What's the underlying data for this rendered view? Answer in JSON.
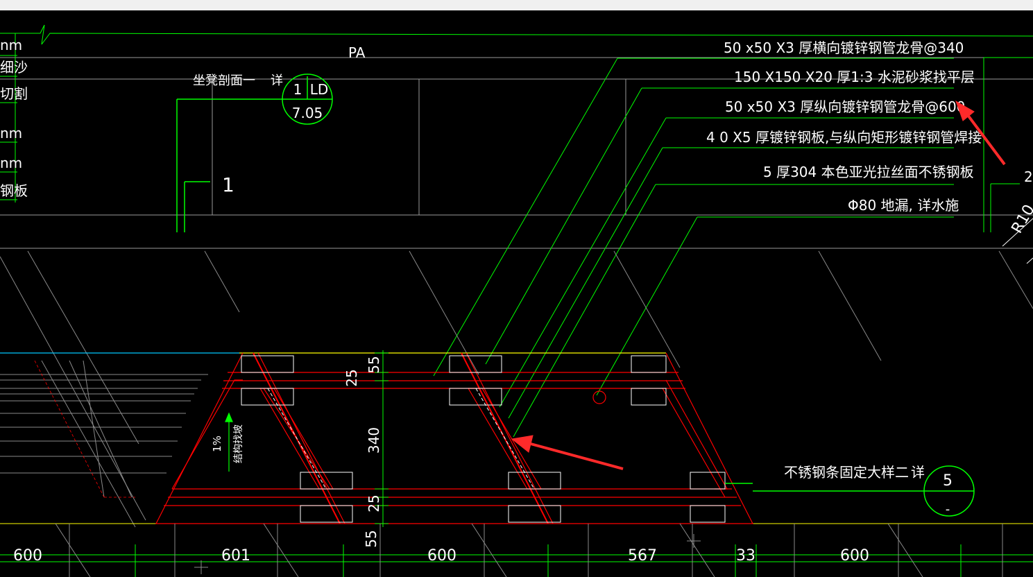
{
  "window": {
    "titlebar_color": "#f0f0f0"
  },
  "colors": {
    "background": "#000000",
    "green": "#00ff00",
    "red": "#ff0000",
    "white": "#ffffff",
    "gray": "#9a9a9a",
    "yellow": "#ffff00",
    "cyan": "#00c8ff",
    "callout_arrow": "#ff2a2a"
  },
  "left_cut_labels": [
    "nm",
    "细沙",
    "切割",
    "nm",
    "nm",
    "钢板"
  ],
  "section": {
    "title": "坐凳剖面一",
    "detail_word": "详",
    "label_pa": "PA",
    "number": "1"
  },
  "detail_bubble_1": {
    "top_left": "1",
    "top_right": "LD",
    "bottom": "7.05"
  },
  "callouts": [
    "50 x50 X3 厚横向镀锌钢管龙骨@340",
    "150 X150 X20 厚1:3 水泥砂浆找平层",
    "50 x50 X3 厚纵向镀锌钢管龙骨@600",
    "4 0 X5 厚镀锌钢板,与纵向矩形镀锌钢管焊接",
    "5 厚304 本色亚光拉丝面不锈钢板",
    "Φ80 地漏, 详水施"
  ],
  "detail_bubble_2": {
    "title": "不锈钢条固定大样二",
    "detail_word": "详",
    "top": "5",
    "bottom": "-"
  },
  "dimensions_vertical": [
    "55",
    "25",
    "340",
    "25",
    "55"
  ],
  "slope": {
    "percent": "1%",
    "note": "结构找坡"
  },
  "right_partial": {
    "radius_label": "R10",
    "digit": "2"
  },
  "bottom_dimensions": [
    "600",
    "601",
    "600",
    "567",
    "33",
    "600"
  ]
}
